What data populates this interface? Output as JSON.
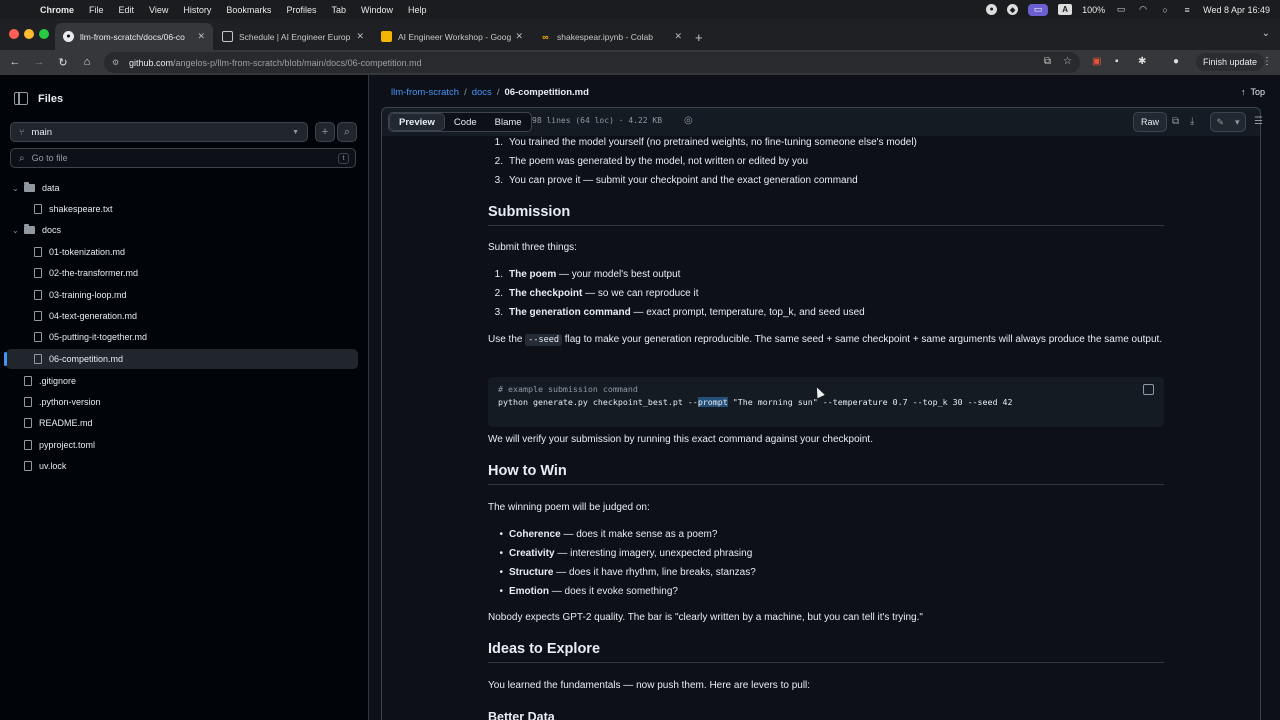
{
  "menubar": {
    "app": "Chrome",
    "items": [
      "File",
      "Edit",
      "View",
      "History",
      "Bookmarks",
      "Profiles",
      "Tab",
      "Window",
      "Help"
    ],
    "battery": "100%",
    "clock": "Wed 8 Apr  16:49"
  },
  "tabs": [
    {
      "title": "llm-from-scratch/docs/06-co",
      "icon": "github-icon"
    },
    {
      "title": "Schedule | AI Engineer Europ",
      "icon": "calendar-icon"
    },
    {
      "title": "AI Engineer Workshop - Goog",
      "icon": "slides-icon"
    },
    {
      "title": "shakespear.ipynb - Colab",
      "icon": "colab-icon"
    }
  ],
  "toolbar": {
    "url_host": "github.com",
    "url_path": "/angelos-p/llm-from-scratch/blob/main/docs/06-competition.md",
    "finish_update": "Finish update"
  },
  "sidebar": {
    "title": "Files",
    "branch": "main",
    "goto_placeholder": "Go to file",
    "goto_shortcut": "t",
    "tree": [
      {
        "label": "data",
        "type": "folder",
        "depth": 0
      },
      {
        "label": "shakespeare.txt",
        "type": "file",
        "depth": 1
      },
      {
        "label": "docs",
        "type": "folder",
        "depth": 0
      },
      {
        "label": "01-tokenization.md",
        "type": "file",
        "depth": 1
      },
      {
        "label": "02-the-transformer.md",
        "type": "file",
        "depth": 1
      },
      {
        "label": "03-training-loop.md",
        "type": "file",
        "depth": 1
      },
      {
        "label": "04-text-generation.md",
        "type": "file",
        "depth": 1
      },
      {
        "label": "05-putting-it-together.md",
        "type": "file",
        "depth": 1
      },
      {
        "label": "06-competition.md",
        "type": "file",
        "depth": 1,
        "selected": true
      },
      {
        "label": ".gitignore",
        "type": "file",
        "depth": 0
      },
      {
        "label": ".python-version",
        "type": "file",
        "depth": 0
      },
      {
        "label": "README.md",
        "type": "file",
        "depth": 0
      },
      {
        "label": "pyproject.toml",
        "type": "file",
        "depth": 0
      },
      {
        "label": "uv.lock",
        "type": "file",
        "depth": 0
      }
    ]
  },
  "main": {
    "breadcrumb": {
      "repo": "llm-from-scratch",
      "folder": "docs",
      "file": "06-competition.md",
      "sep": "/"
    },
    "top_link": "Top",
    "tabs": [
      "Preview",
      "Code",
      "Blame"
    ],
    "file_info": "98 lines (64 loc) · 4.22 KB",
    "raw": "Raw"
  },
  "doc": {
    "rules": [
      {
        "n": "1.",
        "text": "You trained the model yourself (no pretrained weights, no fine-tuning someone else's model)"
      },
      {
        "n": "2.",
        "text": "The poem was generated by the model, not written or edited by you"
      },
      {
        "n": "3.",
        "text": "You can prove it — submit your checkpoint and the exact generation command"
      }
    ],
    "submission_heading": "Submission",
    "submit_intro": "Submit three things:",
    "submit_items": [
      {
        "n": "1.",
        "bold": "The poem",
        "rest": " — your model's best output"
      },
      {
        "n": "2.",
        "bold": "The checkpoint",
        "rest": " — so we can reproduce it"
      },
      {
        "n": "3.",
        "bold": "The generation command",
        "rest": " — exact prompt, temperature, top_k, and seed used"
      }
    ],
    "seed_p_before": "Use the ",
    "seed_code": "--seed",
    "seed_p_after": " flag to make your generation reproducible. The same seed + same checkpoint + same arguments will always produce the same output.",
    "code_comment": "# example submission command",
    "code_pre": "python generate.py checkpoint_best.pt --",
    "code_sel": "prompt",
    "code_post": " \"The morning sun\" --temperature 0.7 --top_k 30 --seed 42",
    "verify_p": "We will verify your submission by running this exact command against your checkpoint.",
    "win_heading": "How to Win",
    "win_intro": "The winning poem will be judged on:",
    "win_items": [
      {
        "bold": "Coherence",
        "rest": " — does it make sense as a poem?"
      },
      {
        "bold": "Creativity",
        "rest": " — interesting imagery, unexpected phrasing"
      },
      {
        "bold": "Structure",
        "rest": " — does it have rhythm, line breaks, stanzas?"
      },
      {
        "bold": "Emotion",
        "rest": " — does it evoke something?"
      }
    ],
    "nobody_p": "Nobody expects GPT-2 quality. The bar is \"clearly written by a machine, but you can tell it's trying.\"",
    "ideas_heading": "Ideas to Explore",
    "ideas_p": "You learned the fundamentals — now push them. Here are levers to pull:",
    "better_data": "Better Data"
  }
}
